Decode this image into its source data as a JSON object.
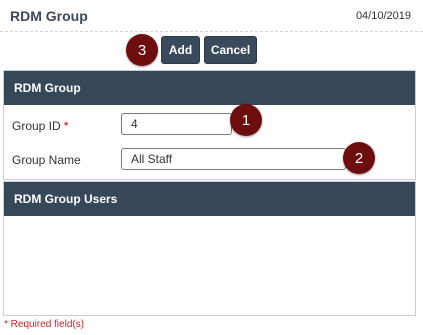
{
  "header": {
    "title": "RDM Group",
    "date": "04/10/2019"
  },
  "toolbar": {
    "add_label": "Add",
    "cancel_label": "Cancel"
  },
  "markers": {
    "one": "1",
    "two": "2",
    "three": "3"
  },
  "group_panel": {
    "title": "RDM Group",
    "group_id_label": "Group ID",
    "required_mark": "*",
    "group_id_value": "4",
    "group_name_label": "Group Name",
    "group_name_value": "All Staff"
  },
  "users_panel": {
    "title": "RDM Group Users"
  },
  "footer": {
    "required_note": "* Required field(s)"
  },
  "colors": {
    "header_bg": "#36475a",
    "button_bg": "#3a4a5c",
    "marker_bg": "#6e0d0d",
    "required": "#cc0000"
  }
}
